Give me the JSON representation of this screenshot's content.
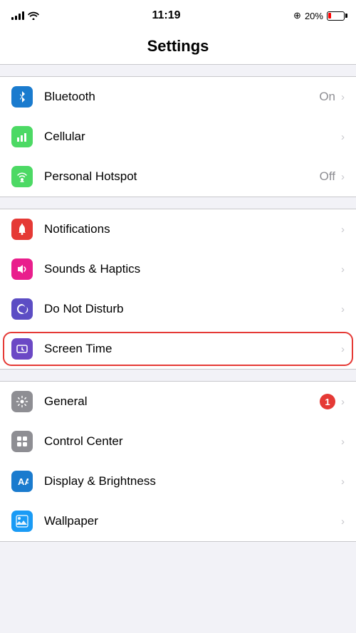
{
  "statusBar": {
    "time": "11:19",
    "battery_percent": "20%",
    "battery_level": 20
  },
  "pageTitle": "Settings",
  "sections": [
    {
      "id": "connectivity",
      "items": [
        {
          "id": "bluetooth",
          "label": "Bluetooth",
          "value": "On",
          "icon": "bluetooth",
          "iconBg": "#1a7bce"
        },
        {
          "id": "cellular",
          "label": "Cellular",
          "value": "",
          "icon": "cellular",
          "iconBg": "#4cd964"
        },
        {
          "id": "hotspot",
          "label": "Personal Hotspot",
          "value": "Off",
          "icon": "hotspot",
          "iconBg": "#4cd964"
        }
      ]
    },
    {
      "id": "notifications",
      "items": [
        {
          "id": "notifications",
          "label": "Notifications",
          "value": "",
          "icon": "notifications",
          "iconBg": "#e53935"
        },
        {
          "id": "sounds",
          "label": "Sounds & Haptics",
          "value": "",
          "icon": "sounds",
          "iconBg": "#e91e8c"
        },
        {
          "id": "donotdisturb",
          "label": "Do Not Disturb",
          "value": "",
          "icon": "donotdisturb",
          "iconBg": "#5c4dc4"
        },
        {
          "id": "screentime",
          "label": "Screen Time",
          "value": "",
          "icon": "screentime",
          "iconBg": "#6b48c5",
          "highlighted": true
        }
      ]
    },
    {
      "id": "system",
      "items": [
        {
          "id": "general",
          "label": "General",
          "value": "",
          "badge": "1",
          "icon": "general",
          "iconBg": "#8e8e93"
        },
        {
          "id": "controlcenter",
          "label": "Control Center",
          "value": "",
          "icon": "controlcenter",
          "iconBg": "#8e8e93"
        },
        {
          "id": "display",
          "label": "Display & Brightness",
          "value": "",
          "icon": "display",
          "iconBg": "#1a7bce"
        },
        {
          "id": "wallpaper",
          "label": "Wallpaper",
          "value": "",
          "icon": "wallpaper",
          "iconBg": "#1a9bf5"
        }
      ]
    }
  ]
}
